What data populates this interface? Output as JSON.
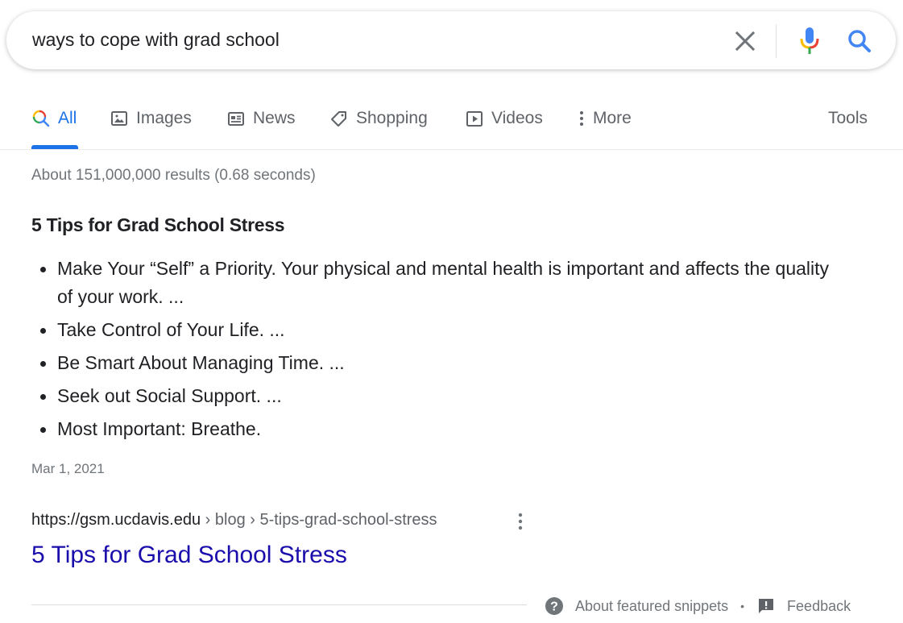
{
  "search": {
    "query": "ways to cope with grad school",
    "clear_icon": "close-icon",
    "voice_icon": "microphone-icon",
    "submit_icon": "search-icon"
  },
  "tabs": [
    {
      "label": "All",
      "icon": "search-icon",
      "active": true
    },
    {
      "label": "Images",
      "icon": "image-icon",
      "active": false
    },
    {
      "label": "News",
      "icon": "newspaper-icon",
      "active": false
    },
    {
      "label": "Shopping",
      "icon": "tag-icon",
      "active": false
    },
    {
      "label": "Videos",
      "icon": "play-icon",
      "active": false
    },
    {
      "label": "More",
      "icon": "more-vertical-icon",
      "active": false
    }
  ],
  "tools_label": "Tools",
  "result_stats": "About 151,000,000 results (0.68 seconds)",
  "featured_snippet": {
    "heading": "5 Tips for Grad School Stress",
    "items": [
      "Make Your “Self” a Priority. Your physical and mental health is important and affects the quality of your work. ...",
      "Take Control of Your Life. ...",
      "Be Smart About Managing Time. ...",
      "Seek out Social Support. ...",
      "Most Important: Breathe."
    ],
    "date": "Mar 1, 2021",
    "source": {
      "domain": "https://gsm.ucdavis.edu",
      "path": " › blog › 5-tips-grad-school-stress",
      "title": "5 Tips for Grad School Stress"
    }
  },
  "footer": {
    "about_label": "About featured snippets",
    "separator": "•",
    "feedback_label": "Feedback"
  },
  "colors": {
    "accent": "#1a73e8",
    "link": "#1a0dab",
    "muted": "#70757a",
    "text": "#202124"
  }
}
